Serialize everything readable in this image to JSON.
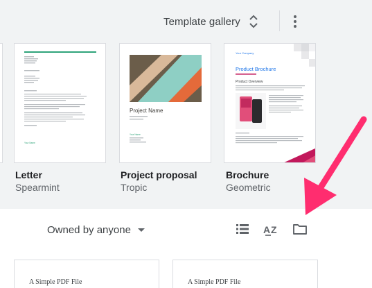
{
  "header": {
    "gallery_label": "Template gallery",
    "more_icon": "more-vert-icon",
    "expand_icon": "unfold-more-icon"
  },
  "templates": [
    {
      "name": "Letter",
      "style": "Spearmint",
      "thumbnail": {
        "accent_color": "#2fa37a",
        "signature": "Your Name"
      }
    },
    {
      "name": "Project proposal",
      "style": "Tropic",
      "thumbnail": {
        "title": "Project Name",
        "colors": [
          "#8ecfc4",
          "#6b5d4a",
          "#e46a3a",
          "#d9b99a"
        ],
        "accent_color": "#2fa37a",
        "author_lines": [
          "Your Name",
          "Your Company"
        ]
      }
    },
    {
      "name": "Brochure",
      "style": "Geometric",
      "thumbnail": {
        "company": "Your Company",
        "title": "Product Brochure",
        "overview_heading": "Product Overview",
        "accent_color": "#c2185b",
        "phone_color": "#e14e7a"
      }
    }
  ],
  "toolbar": {
    "owner_filter": "Owned by anyone",
    "caret_icon": "dropdown-caret-icon",
    "list_icon": "list-view-icon",
    "sort_icon": "sort-az-icon",
    "folder_icon": "folder-icon"
  },
  "documents": [
    {
      "title": "A Simple PDF File"
    },
    {
      "title": "A Simple PDF File"
    }
  ],
  "annotation": {
    "arrow_icon": "pointer-arrow",
    "arrow_color": "#ff2d6f"
  },
  "colors": {
    "gallery_background": "#f1f3f4",
    "text_primary": "#202124",
    "text_secondary": "#5f6368"
  }
}
